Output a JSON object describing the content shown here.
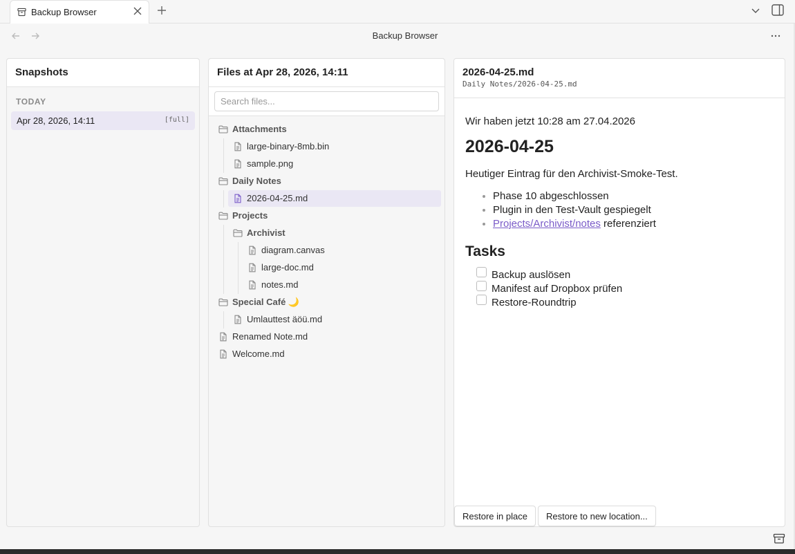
{
  "tab": {
    "title": "Backup Browser",
    "icon": "archive-icon"
  },
  "header": {
    "title": "Backup Browser"
  },
  "snapshots": {
    "title": "Snapshots",
    "group_label": "TODAY",
    "items": [
      {
        "date": "Apr 28, 2026, 14:11",
        "badge": "[full]"
      }
    ]
  },
  "files": {
    "title": "Files at Apr 28, 2026, 14:11",
    "search_placeholder": "Search files...",
    "tree": [
      {
        "type": "folder",
        "label": "Attachments"
      },
      {
        "type": "file",
        "label": "large-binary-8mb.bin"
      },
      {
        "type": "file",
        "label": "sample.png"
      },
      {
        "type": "folder",
        "label": "Daily Notes"
      },
      {
        "type": "file",
        "label": "2026-04-25.md",
        "selected": true
      },
      {
        "type": "folder",
        "label": "Projects"
      },
      {
        "type": "folder",
        "label": "Archivist"
      },
      {
        "type": "file",
        "label": "diagram.canvas"
      },
      {
        "type": "file",
        "label": "large-doc.md"
      },
      {
        "type": "file",
        "label": "notes.md"
      },
      {
        "type": "folder",
        "label": "Special Café 🌙"
      },
      {
        "type": "file",
        "label": "Umlauttest äöü.md"
      },
      {
        "type": "file",
        "label": "Renamed Note.md"
      },
      {
        "type": "file",
        "label": "Welcome.md"
      }
    ]
  },
  "preview": {
    "filename": "2026-04-25.md",
    "path": "Daily Notes/2026-04-25.md",
    "intro": "Wir haben jetzt 10:28 am 27.04.2026",
    "heading": "2026-04-25",
    "paragraph": "Heutiger Eintrag für den Archivist-Smoke-Test.",
    "bullets": [
      "Phase 10 abgeschlossen",
      "Plugin in den Test-Vault gespiegelt"
    ],
    "link_bullet": {
      "link": "Projects/Archivist/notes",
      "suffix": " referenziert"
    },
    "tasks_heading": "Tasks",
    "tasks": [
      "Backup auslösen",
      "Manifest auf Dropbox prüfen",
      "Restore-Roundtrip"
    ],
    "buttons": {
      "restore_in_place": "Restore in place",
      "restore_new": "Restore to new location..."
    }
  },
  "colors": {
    "accent": "#7a5bc8",
    "selection": "#eae7f4"
  }
}
